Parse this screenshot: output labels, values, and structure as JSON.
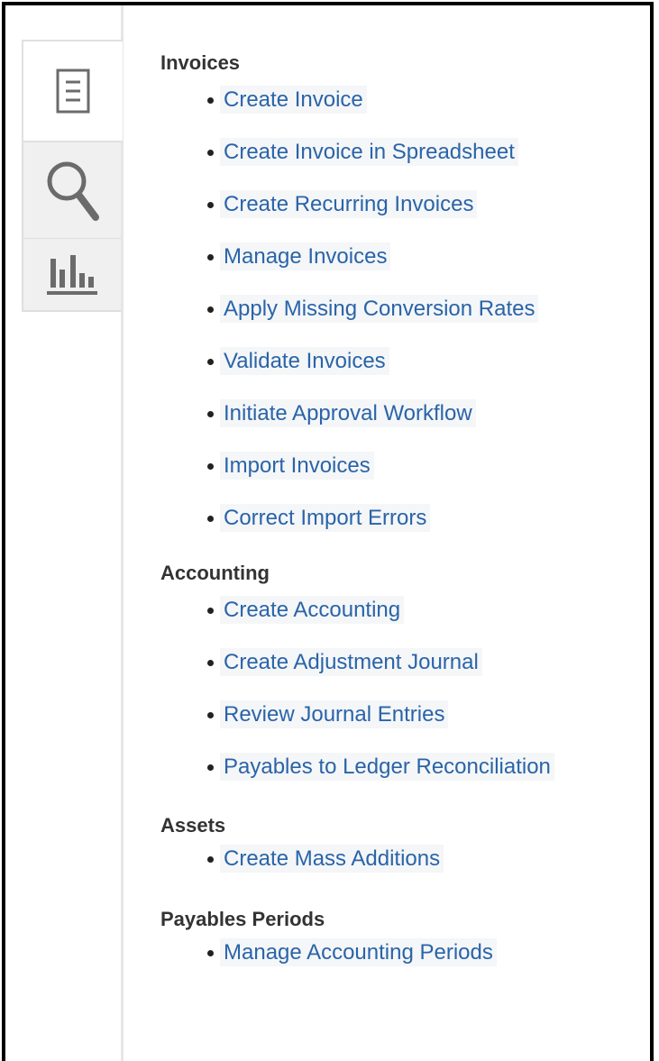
{
  "tabs": [
    {
      "icon": "tasks-list-icon",
      "selected": true
    },
    {
      "icon": "search-icon",
      "selected": false
    },
    {
      "icon": "reports-bar-chart-icon",
      "selected": false
    }
  ],
  "sections": {
    "invoices": {
      "heading": "Invoices",
      "items": [
        "Create Invoice",
        "Create Invoice in Spreadsheet",
        "Create Recurring Invoices",
        "Manage Invoices",
        "Apply Missing Conversion Rates",
        "Validate Invoices",
        "Initiate Approval Workflow",
        "Import Invoices",
        "Correct Import Errors"
      ]
    },
    "accounting": {
      "heading": "Accounting",
      "items": [
        "Create Accounting",
        "Create Adjustment Journal",
        "Review Journal Entries",
        "Payables to Ledger Reconciliation"
      ]
    },
    "assets": {
      "heading": "Assets",
      "items": [
        "Create Mass Additions"
      ]
    },
    "payables_periods": {
      "heading": "Payables Periods",
      "items": [
        "Manage Accounting Periods"
      ]
    }
  },
  "colors": {
    "link": "#2a64a8",
    "heading": "#333333",
    "tab_inactive": "#f0f0f0",
    "icon": "#6b6b6b"
  }
}
